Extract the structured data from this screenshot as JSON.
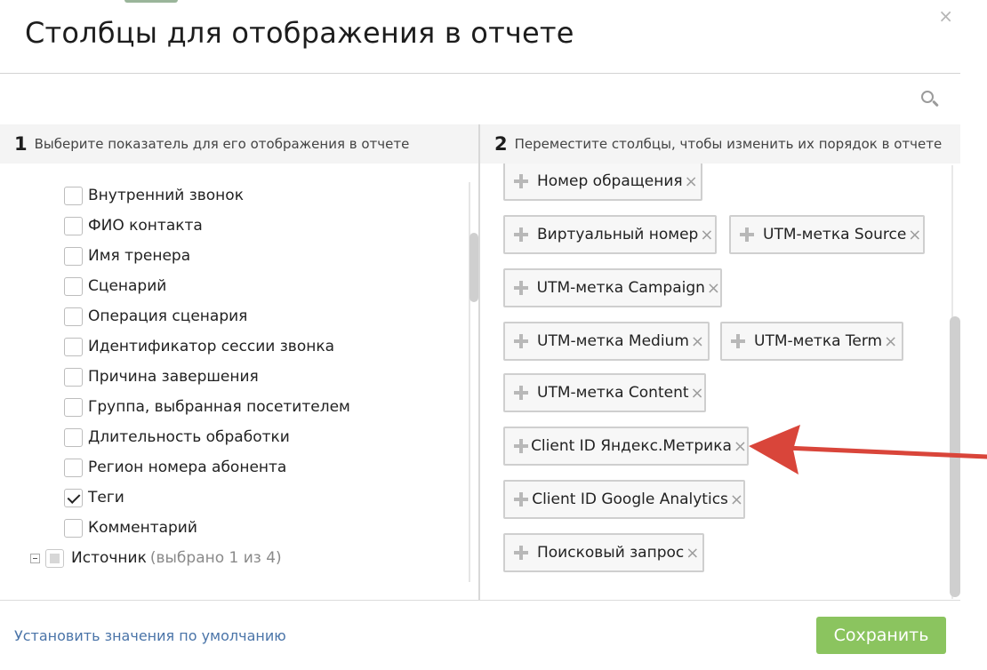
{
  "dialog": {
    "title": "Столбцы для отображения в отчете",
    "close_glyph": "×"
  },
  "search": {
    "value": "",
    "placeholder": ""
  },
  "left_column": {
    "number": "1",
    "heading": "Выберите показатель для его отображения в отчете",
    "items": [
      {
        "label": "Внутренний звонок",
        "checked": false
      },
      {
        "label": "ФИО контакта",
        "checked": false
      },
      {
        "label": "Имя тренера",
        "checked": false
      },
      {
        "label": "Сценарий",
        "checked": false
      },
      {
        "label": "Операция сценария",
        "checked": false
      },
      {
        "label": "Идентификатор сессии звонка",
        "checked": false
      },
      {
        "label": "Причина завершения",
        "checked": false
      },
      {
        "label": "Группа, выбранная посетителем",
        "checked": false
      },
      {
        "label": "Длительность обработки",
        "checked": false
      },
      {
        "label": "Регион номера абонента",
        "checked": false
      },
      {
        "label": "Теги",
        "checked": true
      },
      {
        "label": "Комментарий",
        "checked": false
      }
    ],
    "group": {
      "label": "Источник",
      "sub": "(выбрано 1 из 4)"
    }
  },
  "right_column": {
    "number": "2",
    "heading": "Переместите столбцы, чтобы изменить их порядок в отчете",
    "chips": [
      {
        "label": "Номер обращения",
        "remove": "×"
      },
      {
        "label": "Виртуальный номер",
        "remove": "×"
      },
      {
        "label": "UTM-метка Source",
        "remove": "×"
      },
      {
        "label": "UTM-метка Campaign",
        "remove": "×"
      },
      {
        "label": "UTM-метка Medium",
        "remove": "×"
      },
      {
        "label": "UTM-метка Term",
        "remove": "×"
      },
      {
        "label": "UTM-метка Content",
        "remove": "×"
      },
      {
        "label": "Client ID Яндекс.Метрика",
        "remove": "×"
      },
      {
        "label": "Client ID Google Analytics",
        "remove": "×"
      },
      {
        "label": "Поисковый запрос",
        "remove": "×"
      }
    ]
  },
  "footer": {
    "reset_label": "Установить значения по умолчанию",
    "save_label": "Сохранить"
  },
  "colors": {
    "accent_green": "#8bc45f",
    "link_blue": "#4a74a8",
    "arrow_red": "#d9453a"
  }
}
